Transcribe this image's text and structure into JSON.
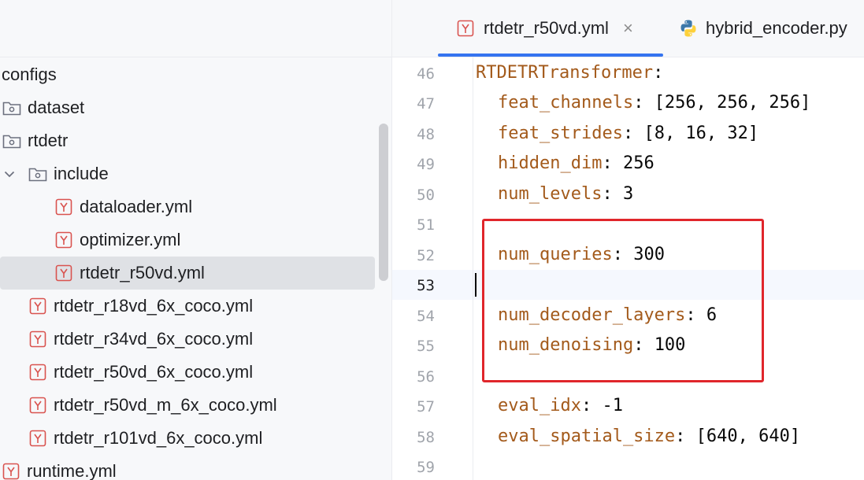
{
  "sidebar": {
    "items": [
      {
        "label": "configs",
        "type": "root"
      },
      {
        "label": "dataset",
        "type": "folder"
      },
      {
        "label": "rtdetr",
        "type": "folder"
      },
      {
        "label": "include",
        "type": "folder-open"
      },
      {
        "label": "dataloader.yml",
        "type": "yml"
      },
      {
        "label": "optimizer.yml",
        "type": "yml"
      },
      {
        "label": "rtdetr_r50vd.yml",
        "type": "yml",
        "selected": true
      },
      {
        "label": "rtdetr_r18vd_6x_coco.yml",
        "type": "yml"
      },
      {
        "label": "rtdetr_r34vd_6x_coco.yml",
        "type": "yml"
      },
      {
        "label": "rtdetr_r50vd_6x_coco.yml",
        "type": "yml"
      },
      {
        "label": "rtdetr_r50vd_m_6x_coco.yml",
        "type": "yml"
      },
      {
        "label": "rtdetr_r101vd_6x_coco.yml",
        "type": "yml"
      },
      {
        "label": "runtime.yml",
        "type": "yml"
      }
    ]
  },
  "tabs": [
    {
      "label": "rtdetr_r50vd.yml",
      "icon": "yml-icon",
      "active": true,
      "close": "×"
    },
    {
      "label": "hybrid_encoder.py",
      "icon": "python-icon",
      "active": false
    }
  ],
  "editor": {
    "current_line": 53,
    "lines": [
      {
        "no": "46",
        "key": "RTDETRTransformer",
        "sep": ":",
        "value": ""
      },
      {
        "no": "47",
        "key": "feat_channels",
        "sep": ": ",
        "value": "[256, 256, 256]"
      },
      {
        "no": "48",
        "key": "feat_strides",
        "sep": ": ",
        "value": "[8, 16, 32]"
      },
      {
        "no": "49",
        "key": "hidden_dim",
        "sep": ": ",
        "value": "256"
      },
      {
        "no": "50",
        "key": "num_levels",
        "sep": ": ",
        "value": "3"
      },
      {
        "no": "51",
        "key": "",
        "sep": "",
        "value": ""
      },
      {
        "no": "52",
        "key": "num_queries",
        "sep": ": ",
        "value": "300"
      },
      {
        "no": "53",
        "key": "",
        "sep": "",
        "value": ""
      },
      {
        "no": "54",
        "key": "num_decoder_layers",
        "sep": ": ",
        "value": "6"
      },
      {
        "no": "55",
        "key": "num_denoising",
        "sep": ": ",
        "value": "100"
      },
      {
        "no": "56",
        "key": "",
        "sep": "",
        "value": ""
      },
      {
        "no": "57",
        "key": "eval_idx",
        "sep": ": ",
        "value": "-1"
      },
      {
        "no": "58",
        "key": "eval_spatial_size",
        "sep": ": ",
        "value": "[640, 640]"
      },
      {
        "no": "59",
        "key": "",
        "sep": "",
        "value": ""
      }
    ]
  },
  "colors": {
    "accent": "#3574f0",
    "highlight_box": "#e0262b",
    "yaml_key": "#a35a1b",
    "yml_icon": "#d9534f"
  }
}
